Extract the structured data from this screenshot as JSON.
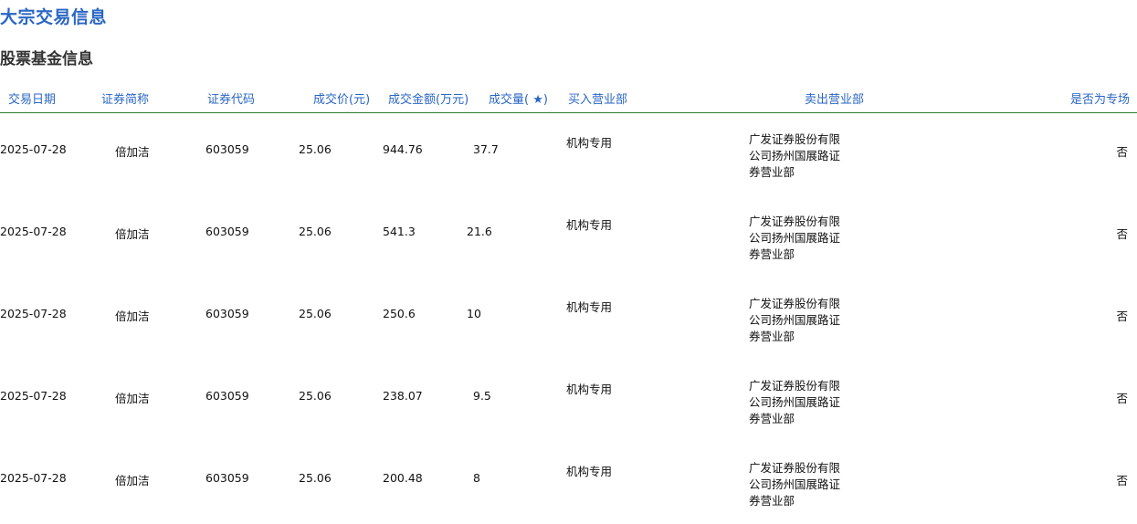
{
  "page": {
    "title": "大宗交易信息",
    "section_title": "股票基金信息"
  },
  "table": {
    "headers": {
      "date": "交易日期",
      "name": "证券简称",
      "code": "证券代码",
      "price": "成交价(元)",
      "amount": "成交金额(万元)",
      "volume": "成交量( ★)",
      "buyer": "买入营业部",
      "seller": "卖出营业部",
      "special": "是否为专场"
    },
    "rows": [
      {
        "date": "2025-07-28",
        "name": "倍加洁",
        "code": "603059",
        "price": "25.06",
        "amount": "944.76",
        "volume": "37.7",
        "buyer": "机构专用",
        "seller": "广发证券股份有限公司扬州国展路证券营业部",
        "special": "否"
      },
      {
        "date": "2025-07-28",
        "name": "倍加洁",
        "code": "603059",
        "price": "25.06",
        "amount": "541.3",
        "volume": "21.6",
        "buyer": "机构专用",
        "seller": "广发证券股份有限公司扬州国展路证券营业部",
        "special": "否"
      },
      {
        "date": "2025-07-28",
        "name": "倍加洁",
        "code": "603059",
        "price": "25.06",
        "amount": "250.6",
        "volume": "10",
        "buyer": "机构专用",
        "seller": "广发证券股份有限公司扬州国展路证券营业部",
        "special": "否"
      },
      {
        "date": "2025-07-28",
        "name": "倍加洁",
        "code": "603059",
        "price": "25.06",
        "amount": "238.07",
        "volume": "9.5",
        "buyer": "机构专用",
        "seller": "广发证券股份有限公司扬州国展路证券营业部",
        "special": "否"
      },
      {
        "date": "2025-07-28",
        "name": "倍加洁",
        "code": "603059",
        "price": "25.06",
        "amount": "200.48",
        "volume": "8",
        "buyer": "机构专用",
        "seller": "广发证券股份有限公司扬州国展路证券营业部",
        "special": "否"
      }
    ]
  }
}
